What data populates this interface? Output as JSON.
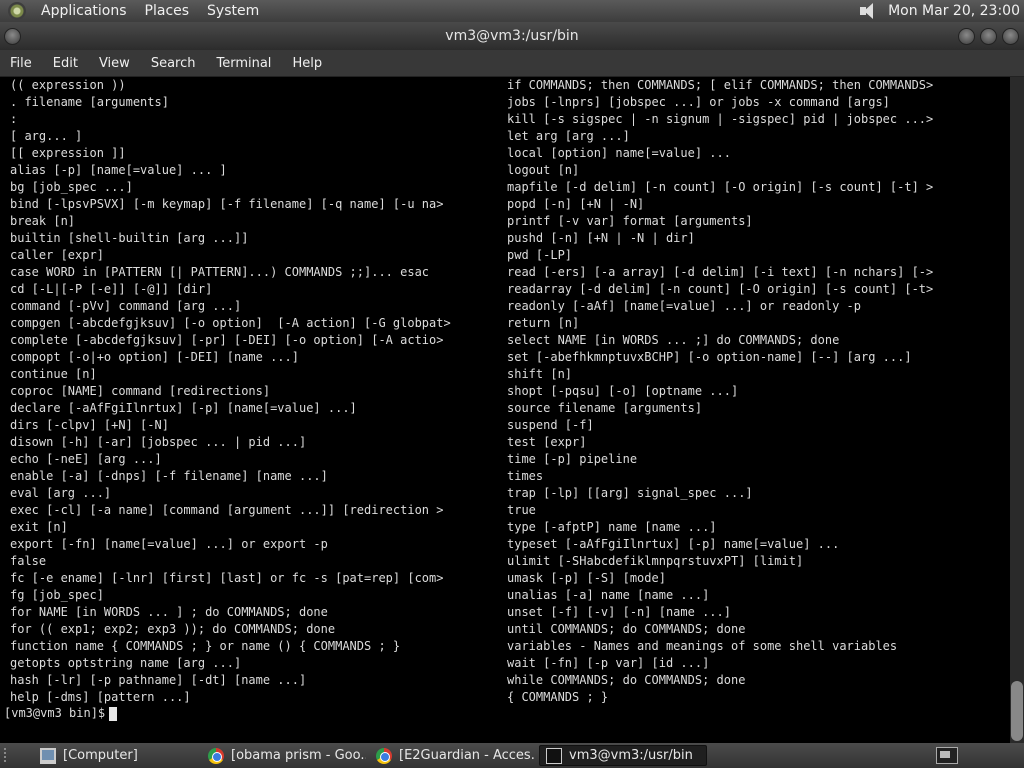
{
  "top_panel": {
    "menus": [
      "Applications",
      "Places",
      "System"
    ],
    "clock": "Mon Mar 20, 23:00"
  },
  "window": {
    "title": "vm3@vm3:/usr/bin"
  },
  "menubar": [
    "File",
    "Edit",
    "View",
    "Search",
    "Terminal",
    "Help"
  ],
  "terminal": {
    "left_lines": [
      "(( expression ))",
      ". filename [arguments]",
      ":",
      "[ arg... ]",
      "[[ expression ]]",
      "alias [-p] [name[=value] ... ]",
      "bg [job_spec ...]",
      "bind [-lpsvPSVX] [-m keymap] [-f filename] [-q name] [-u na>",
      "break [n]",
      "builtin [shell-builtin [arg ...]]",
      "caller [expr]",
      "case WORD in [PATTERN [| PATTERN]...) COMMANDS ;;]... esac",
      "cd [-L|[-P [-e]] [-@]] [dir]",
      "command [-pVv] command [arg ...]",
      "compgen [-abcdefgjksuv] [-o option]  [-A action] [-G globpat>",
      "complete [-abcdefgjksuv] [-pr] [-DEI] [-o option] [-A actio>",
      "compopt [-o|+o option] [-DEI] [name ...]",
      "continue [n]",
      "coproc [NAME] command [redirections]",
      "declare [-aAfFgiIlnrtux] [-p] [name[=value] ...]",
      "dirs [-clpv] [+N] [-N]",
      "disown [-h] [-ar] [jobspec ... | pid ...]",
      "echo [-neE] [arg ...]",
      "enable [-a] [-dnps] [-f filename] [name ...]",
      "eval [arg ...]",
      "exec [-cl] [-a name] [command [argument ...]] [redirection >",
      "exit [n]",
      "export [-fn] [name[=value] ...] or export -p",
      "false",
      "fc [-e ename] [-lnr] [first] [last] or fc -s [pat=rep] [com>",
      "fg [job_spec]",
      "for NAME [in WORDS ... ] ; do COMMANDS; done",
      "for (( exp1; exp2; exp3 )); do COMMANDS; done",
      "function name { COMMANDS ; } or name () { COMMANDS ; }",
      "getopts optstring name [arg ...]",
      "hash [-lr] [-p pathname] [-dt] [name ...]",
      "help [-dms] [pattern ...]"
    ],
    "right_lines": [
      "if COMMANDS; then COMMANDS; [ elif COMMANDS; then COMMANDS>",
      "jobs [-lnprs] [jobspec ...] or jobs -x command [args]",
      "kill [-s sigspec | -n signum | -sigspec] pid | jobspec ...>",
      "let arg [arg ...]",
      "local [option] name[=value] ...",
      "logout [n]",
      "mapfile [-d delim] [-n count] [-O origin] [-s count] [-t] >",
      "popd [-n] [+N | -N]",
      "printf [-v var] format [arguments]",
      "pushd [-n] [+N | -N | dir]",
      "pwd [-LP]",
      "read [-ers] [-a array] [-d delim] [-i text] [-n nchars] [->",
      "readarray [-d delim] [-n count] [-O origin] [-s count] [-t>",
      "readonly [-aAf] [name[=value] ...] or readonly -p",
      "return [n]",
      "select NAME [in WORDS ... ;] do COMMANDS; done",
      "set [-abefhkmnptuvxBCHP] [-o option-name] [--] [arg ...]",
      "shift [n]",
      "shopt [-pqsu] [-o] [optname ...]",
      "source filename [arguments]",
      "suspend [-f]",
      "test [expr]",
      "time [-p] pipeline",
      "times",
      "trap [-lp] [[arg] signal_spec ...]",
      "true",
      "type [-afptP] name [name ...]",
      "typeset [-aAfFgiIlnrtux] [-p] name[=value] ...",
      "ulimit [-SHabcdefiklmnpqrstuvxPT] [limit]",
      "umask [-p] [-S] [mode]",
      "unalias [-a] name [name ...]",
      "unset [-f] [-v] [-n] [name ...]",
      "until COMMANDS; do COMMANDS; done",
      "variables - Names and meanings of some shell variables",
      "wait [-fn] [-p var] [id ...]",
      "while COMMANDS; do COMMANDS; done",
      "{ COMMANDS ; }"
    ],
    "prompt": "[vm3@vm3 bin]$"
  },
  "taskbar": {
    "tasks": [
      {
        "label": "[Computer]",
        "icon": "computer-icon"
      },
      {
        "label": "[obama prism - Goo...",
        "icon": "chrome-icon"
      },
      {
        "label": "[E2Guardian - Acces...",
        "icon": "chrome-icon"
      },
      {
        "label": "vm3@vm3:/usr/bin",
        "icon": "terminal-icon"
      }
    ]
  }
}
